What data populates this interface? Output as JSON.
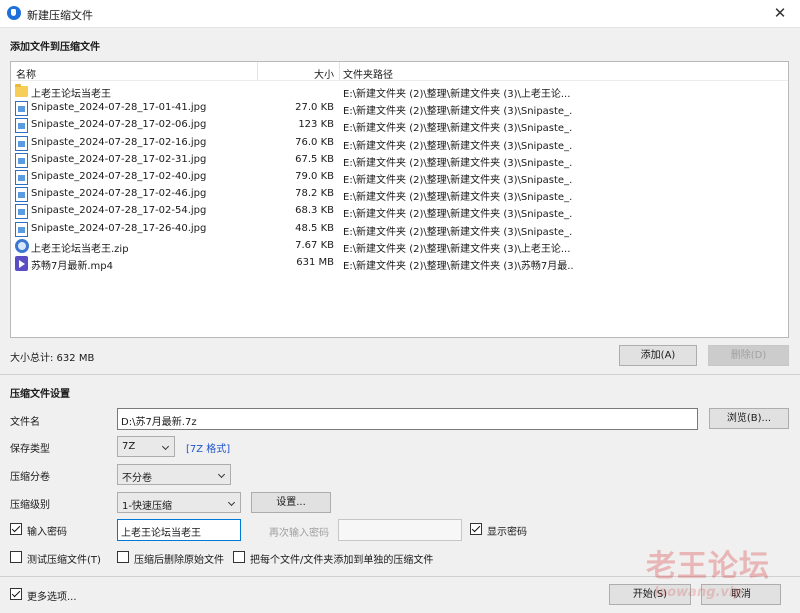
{
  "window": {
    "title": "新建压缩文件",
    "close_glyph": "✕"
  },
  "files_section": {
    "title": "添加文件到压缩文件",
    "columns": {
      "name": "名称",
      "size": "大小",
      "path": "文件夹路径"
    },
    "rows": [
      {
        "icon": "folder-icon",
        "name": "上老王论坛当老王",
        "size": "",
        "path": "E:\\新建文件夹 (2)\\整理\\新建文件夹 (3)\\上老王论..."
      },
      {
        "icon": "image-file-icon",
        "name": "Snipaste_2024-07-28_17-01-41.jpg",
        "size": "27.0 KB",
        "path": "E:\\新建文件夹 (2)\\整理\\新建文件夹 (3)\\Snipaste_..."
      },
      {
        "icon": "image-file-icon",
        "name": "Snipaste_2024-07-28_17-02-06.jpg",
        "size": "123 KB",
        "path": "E:\\新建文件夹 (2)\\整理\\新建文件夹 (3)\\Snipaste_..."
      },
      {
        "icon": "image-file-icon",
        "name": "Snipaste_2024-07-28_17-02-16.jpg",
        "size": "76.0 KB",
        "path": "E:\\新建文件夹 (2)\\整理\\新建文件夹 (3)\\Snipaste_..."
      },
      {
        "icon": "image-file-icon",
        "name": "Snipaste_2024-07-28_17-02-31.jpg",
        "size": "67.5 KB",
        "path": "E:\\新建文件夹 (2)\\整理\\新建文件夹 (3)\\Snipaste_..."
      },
      {
        "icon": "image-file-icon",
        "name": "Snipaste_2024-07-28_17-02-40.jpg",
        "size": "79.0 KB",
        "path": "E:\\新建文件夹 (2)\\整理\\新建文件夹 (3)\\Snipaste_..."
      },
      {
        "icon": "image-file-icon",
        "name": "Snipaste_2024-07-28_17-02-46.jpg",
        "size": "78.2 KB",
        "path": "E:\\新建文件夹 (2)\\整理\\新建文件夹 (3)\\Snipaste_..."
      },
      {
        "icon": "image-file-icon",
        "name": "Snipaste_2024-07-28_17-02-54.jpg",
        "size": "68.3 KB",
        "path": "E:\\新建文件夹 (2)\\整理\\新建文件夹 (3)\\Snipaste_..."
      },
      {
        "icon": "image-file-icon",
        "name": "Snipaste_2024-07-28_17-26-40.jpg",
        "size": "48.5 KB",
        "path": "E:\\新建文件夹 (2)\\整理\\新建文件夹 (3)\\Snipaste_..."
      },
      {
        "icon": "zip-file-icon",
        "name": "上老王论坛当老王.zip",
        "size": "7.67 KB",
        "path": "E:\\新建文件夹 (2)\\整理\\新建文件夹 (3)\\上老王论..."
      },
      {
        "icon": "video-file-icon",
        "name": "苏畅7月最新.mp4",
        "size": "631 MB",
        "path": "E:\\新建文件夹 (2)\\整理\\新建文件夹 (3)\\苏畅7月最..."
      }
    ],
    "total_size": "大小总计: 632 MB",
    "add_button": "添加(A)",
    "delete_button": "删除(D)"
  },
  "settings": {
    "title": "压缩文件设置",
    "filename_label": "文件名",
    "filename_value": "D:\\苏7月最新.7z",
    "browse_button": "浏览(B)...",
    "save_type_label": "保存类型",
    "save_type_value": "7Z",
    "format_link": "[7Z 格式]",
    "split_label": "压缩分卷",
    "split_value": "不分卷",
    "level_label": "压缩级别",
    "level_value": "1-快速压缩",
    "settings_button": "设置...",
    "password_checkbox": "输入密码",
    "password_value": "上老王论坛当老王",
    "reenter_label": "再次输入密码",
    "reenter_value": "",
    "show_password": "显示密码",
    "test_checkbox": "测试压缩文件(T)",
    "delete_after_checkbox": "压缩后删除原始文件",
    "separate_checkbox": "把每个文件/文件夹添加到单独的压缩文件"
  },
  "footer": {
    "more_options": "更多选项...",
    "start_button": "开始(S)",
    "cancel_button": "取消"
  },
  "watermark": {
    "text": "老王论坛",
    "sub": "laowang.vip"
  },
  "colors": {
    "accent": "#0078d7",
    "link": "#2255cc",
    "folder": "#f5cd57"
  }
}
